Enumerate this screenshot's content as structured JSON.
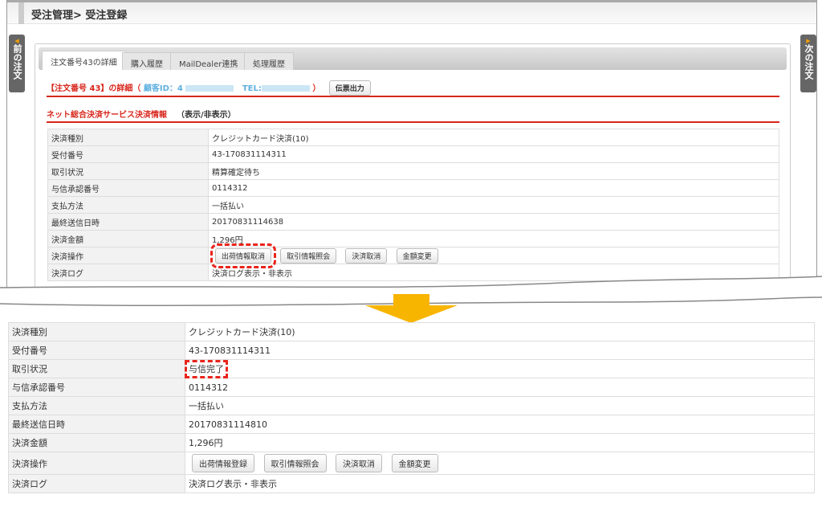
{
  "header": {
    "breadcrumb": "受注管理> 受注登録"
  },
  "prev_order": "前の注文",
  "next_order": "次の注文",
  "tabs": [
    {
      "label": "注文番号43の詳細"
    },
    {
      "label": "購入履歴"
    },
    {
      "label": "MailDealer連携"
    },
    {
      "label": "処理履歴"
    }
  ],
  "detail_title": {
    "prefix": "【注文番号 43】の詳細（",
    "customer_id": "顧客ID：4",
    "tel": "TEL:",
    "suffix": "）",
    "slip_button": "伝票出力"
  },
  "section": {
    "title": "ネット総合決済サービス決済情報",
    "toggle": "（表示/非表示）"
  },
  "labels": [
    "決済種別",
    "受付番号",
    "取引状況",
    "与信承認番号",
    "支払方法",
    "最終送信日時",
    "決済金額",
    "決済操作",
    "決済ログ"
  ],
  "before": {
    "values": [
      "クレジットカード決済(10)",
      "43-170831114311",
      "精算確定待ち",
      "0114312",
      "一括払い",
      "20170831114638",
      "1,296円"
    ],
    "buttons": [
      "出荷情報取消",
      "取引情報照会",
      "決済取消",
      "金額変更"
    ],
    "log": "決済ログ表示・非表示"
  },
  "after": {
    "values": [
      "クレジットカード決済(10)",
      "43-170831114311",
      "与信完了",
      "0114312",
      "一括払い",
      "20170831114810",
      "1,296円"
    ],
    "buttons": [
      "出荷情報登録",
      "取引情報照会",
      "決済取消",
      "金額変更"
    ],
    "log": "決済ログ表示・非表示"
  },
  "colors": {
    "accent_red": "#d8261c",
    "arrow": "#f8b500"
  }
}
